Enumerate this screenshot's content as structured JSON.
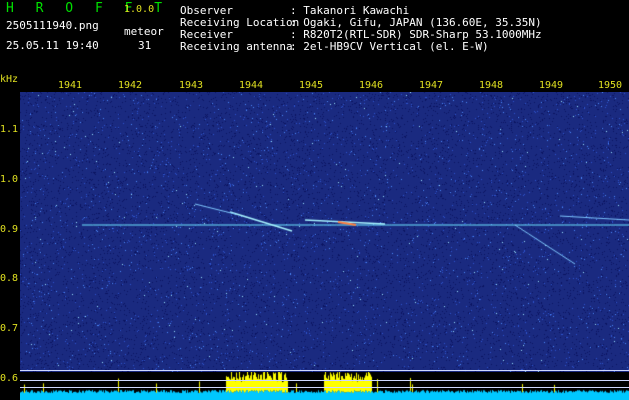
{
  "app": {
    "name": "H R O F F T",
    "version": "1.0.0"
  },
  "file": {
    "name": "2505111940.png",
    "datetime": "25.05.11 19:40"
  },
  "meteor": {
    "label": "meteor",
    "count": "31"
  },
  "station": [
    {
      "key": "Observer",
      "value": ": Takanori Kawachi"
    },
    {
      "key": "Receiving Location",
      "value": ": Ogaki, Gifu, JAPAN (136.60E, 35.35N)"
    },
    {
      "key": "Receiver",
      "value": ": R820T2(RTL-SDR) SDR-Sharp 53.1000MHz"
    },
    {
      "key": "Receiving antenna",
      "value": ": 2el-HB9CV Vertical (el. E-W)"
    }
  ],
  "axis": {
    "unit": "kHz",
    "y_ticks": [
      "1.1",
      "1.0",
      "0.9",
      "0.8",
      "0.7",
      "0.6"
    ],
    "x_ticks": [
      "1941",
      "1942",
      "1943",
      "1944",
      "1945",
      "1946",
      "1947",
      "1948",
      "1949",
      "1950"
    ]
  },
  "colors": {
    "background": "#000000",
    "waterfall": "#1a2a80",
    "label": "#e0e020",
    "title": "#00e000",
    "text": "#ffffff",
    "carrier": "#6ee6ff",
    "strip": "#00c8ff",
    "burst": "#ffff00"
  }
}
